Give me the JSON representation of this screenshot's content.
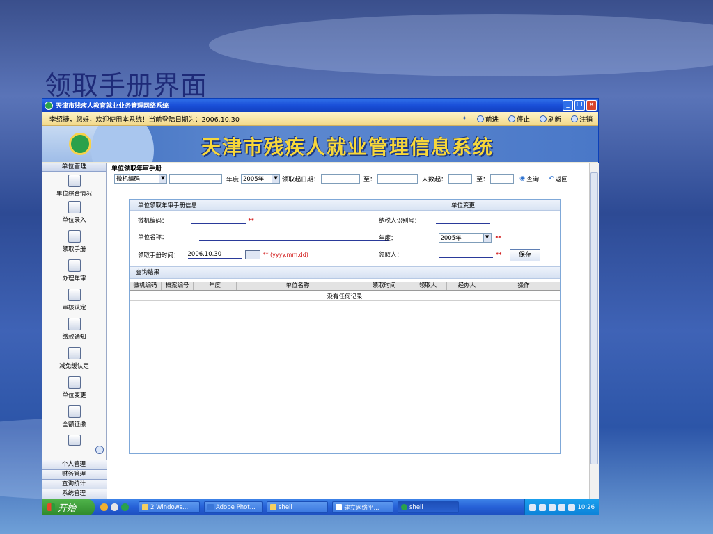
{
  "slide_title": "领取手册界面",
  "window": {
    "title": "天津市残疾人教育就业业务管理网络系统",
    "controls": [
      "minimize-icon",
      "restore-icon",
      "close-icon"
    ]
  },
  "greeting": {
    "text": "李绍捷，您好，欢迎使用本系统！当前登陆日期为：2006.10.30",
    "nav": {
      "forward": "前进",
      "stop": "停止",
      "refresh": "刷新",
      "logout": "注销"
    }
  },
  "banner": {
    "title": "天津市残疾人就业管理信息系统"
  },
  "sidebar": {
    "header": "单位管理",
    "items": [
      {
        "label": "单位综合情况",
        "icon": "document-icon"
      },
      {
        "label": "单位录入",
        "icon": "folder-icon"
      },
      {
        "label": "领取手册",
        "icon": "disk-icon"
      },
      {
        "label": "办理年审",
        "icon": "form-icon"
      },
      {
        "label": "审核认定",
        "icon": "house-icon"
      },
      {
        "label": "缴款通知",
        "icon": "envelope-icon"
      },
      {
        "label": "减免缓认定",
        "icon": "magnifier-doc-icon"
      },
      {
        "label": "单位变更",
        "icon": "computer-icon"
      },
      {
        "label": "全额征缴",
        "icon": "form-icon"
      }
    ],
    "bottom": [
      "个人管理",
      "财务管理",
      "查询统计",
      "系统管理"
    ]
  },
  "breadcrumb": "单位领取年审手册",
  "filter": {
    "field_select": "微机编码",
    "year_label": "年度",
    "year_value": "2005年",
    "date_from_label": "领取起日期：",
    "to_label_1": "至：",
    "count_from_label": "人数起：",
    "to_label_2": "至：",
    "query_label": "查询",
    "back_label": "返回"
  },
  "form": {
    "header": "单位领取年审手册信息",
    "change_link": "单位变更",
    "code_label": "微机编码：",
    "taxid_label": "纳税人识别号：",
    "name_label": "单位名称：",
    "year_label": "年度：",
    "year_value": "2005年",
    "time_label": "领取手册时间：",
    "time_value": "2006.10.30",
    "date_hint": "** (yyyy.mm.dd)",
    "receiver_label": "领取人：",
    "required_mark": "**",
    "save_label": "保存"
  },
  "results": {
    "header": "查询结果",
    "columns": [
      "微机编码",
      "档案编号",
      "年度",
      "单位名称",
      "领取时间",
      "领取人",
      "经办人",
      "操作"
    ],
    "empty_text": "没有任何记录"
  },
  "taskbar": {
    "start_label": "开始",
    "tasks": [
      "2 Windows...",
      "Adobe Phot...",
      "shell",
      "建立网络平...",
      "shell"
    ],
    "clock": "10:26"
  },
  "colors": {
    "window_title": "#1a4fd8",
    "greeting_bg": "#f2d98a",
    "banner_title": "#f7d73a",
    "required": "#d01010"
  }
}
